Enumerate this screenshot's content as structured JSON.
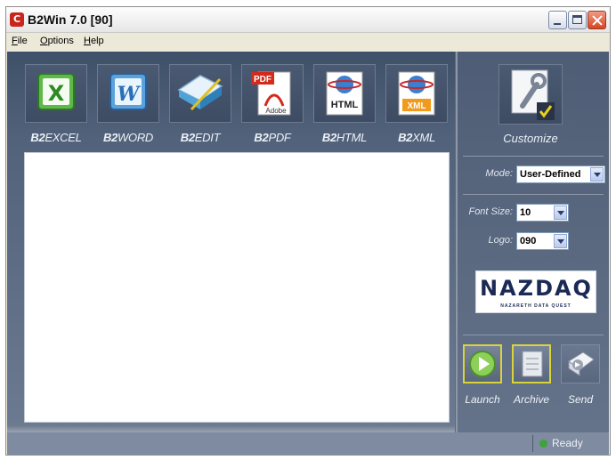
{
  "window": {
    "title": "B2Win 7.0 [90]",
    "app_icon_glyph": "C"
  },
  "menu": [
    "File",
    "Options",
    "Help"
  ],
  "tools": [
    {
      "prefix": "B2",
      "suffix": "EXCEL",
      "icon": "excel-icon"
    },
    {
      "prefix": "B2",
      "suffix": "WORD",
      "icon": "word-icon"
    },
    {
      "prefix": "B2",
      "suffix": "EDIT",
      "icon": "edit-icon"
    },
    {
      "prefix": "B2",
      "suffix": "PDF",
      "icon": "pdf-icon"
    },
    {
      "prefix": "B2",
      "suffix": "HTML",
      "icon": "html-icon"
    },
    {
      "prefix": "B2",
      "suffix": "XML",
      "icon": "xml-icon"
    }
  ],
  "icons": {
    "excel_glyph": "X",
    "word_glyph": "W",
    "pdf_badge": "PDF",
    "pdf_brand": "Adobe",
    "html_badge": "HTML",
    "xml_badge": "XML"
  },
  "customize": {
    "label": "Customize",
    "icon": "wrench-check-icon"
  },
  "settings": {
    "mode_label": "Mode:",
    "mode_value": "User-Defined",
    "font_size_label": "Font Size:",
    "font_size_value": "10",
    "logo_label": "Logo:",
    "logo_value": "090"
  },
  "logo": {
    "name": "NAZDAQ",
    "tagline": "NAZARETH DATA QUEST"
  },
  "actions": [
    {
      "label": "Launch",
      "icon": "play-icon"
    },
    {
      "label": "Archive",
      "icon": "archive-icon"
    },
    {
      "label": "Send",
      "icon": "send-envelope-icon"
    }
  ],
  "status": {
    "text": "Ready"
  },
  "colors": {
    "panel": "#5b6a82",
    "status_ok": "#3ea33a",
    "highlight": "#d9d43a"
  }
}
